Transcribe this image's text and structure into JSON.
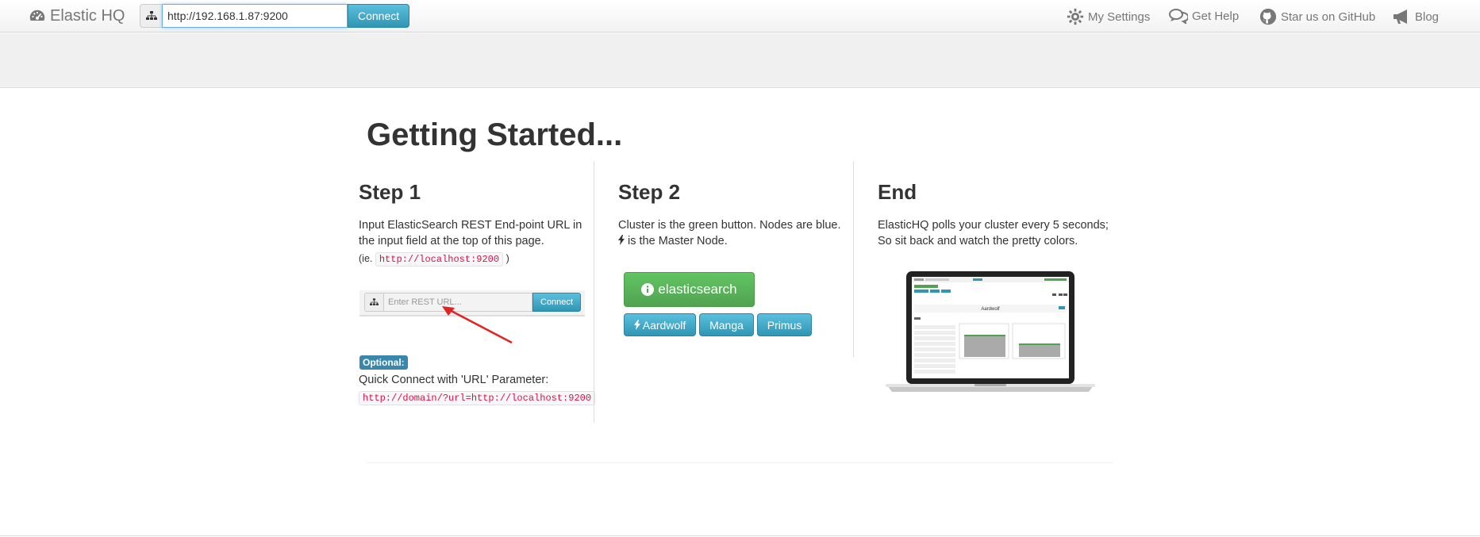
{
  "navbar": {
    "brand": "Elastic HQ",
    "url_value": "http://192.168.1.87:9200",
    "connect_label": "Connect",
    "links": [
      {
        "label": "My Settings",
        "icon": "gear-icon"
      },
      {
        "label": "Get Help",
        "icon": "chat-icon"
      },
      {
        "label": "Star us on GitHub",
        "icon": "github-icon"
      },
      {
        "label": "Blog",
        "icon": "megaphone-icon"
      }
    ]
  },
  "main": {
    "title": "Getting Started...",
    "step1": {
      "heading": "Step 1",
      "text": "Input ElasticSearch REST End-point URL in the input field at the top of this page.",
      "example_prefix": "(ie.",
      "example_code": "http://localhost:9200",
      "example_suffix": ")",
      "mini_placeholder": "Enter REST URL...",
      "mini_connect": "Connect",
      "optional_label": "Optional:",
      "quick_text": "Quick Connect with 'URL' Parameter:",
      "quick_code": "http://domain/?url=http://localhost:9200"
    },
    "step2": {
      "heading": "Step 2",
      "text": "Cluster is the green button. Nodes are blue.",
      "text2": "is the Master Node.",
      "cluster_button": "elasticsearch",
      "nodes": [
        "Aardwolf",
        "Manga",
        "Primus"
      ]
    },
    "end": {
      "heading": "End",
      "text": "ElasticHQ polls your cluster every 5 seconds; So sit back and watch the pretty colors.",
      "laptop_screen_title": "Aardwolf"
    }
  },
  "colors": {
    "primary_info": "#2f96b4",
    "success": "#51a351",
    "label_info": "#3a87ad",
    "code_red": "#d14"
  }
}
